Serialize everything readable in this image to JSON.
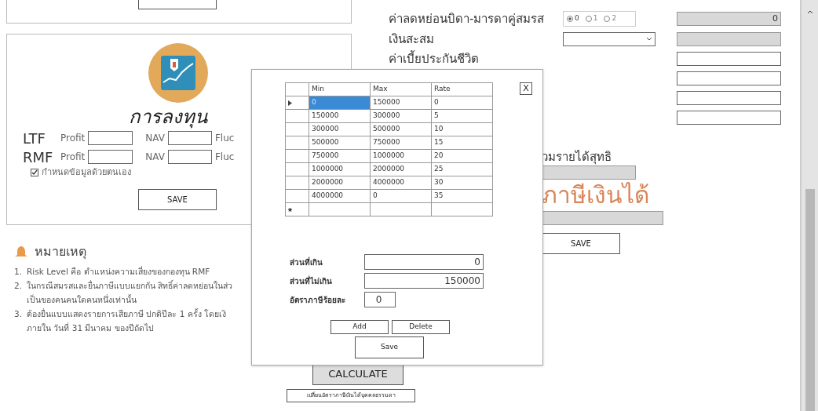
{
  "investment": {
    "title": "การลงทุน",
    "funds": [
      {
        "name": "LTF",
        "profit_label": "Profit",
        "nav_label": "NAV",
        "fluc_label": "Fluc"
      },
      {
        "name": "RMF",
        "profit_label": "Profit",
        "nav_label": "NAV",
        "fluc_label": "Fluc"
      }
    ],
    "manual_checkbox": {
      "label": "กำหนดข้อมูลด้วยตนเอง",
      "checked": true
    },
    "save_button": "SAVE"
  },
  "notes": {
    "title": "หมายเหตุ",
    "items": [
      {
        "number": "1.",
        "lines": [
          "Risk Level คือ ตำแหน่งความเสี่ยงของกองทุน RMF"
        ]
      },
      {
        "number": "2.",
        "lines": [
          "ในกรณีสมรสและยื่นภาษีแบบแยกกัน สิทธิ์ค่าลดหย่อนในส่ว",
          "เป็นของคนคนใดคนหนึ่งเท่านั้น"
        ]
      },
      {
        "number": "3.",
        "lines": [
          "ต้องยื่นแบบแสดงรายการเสียภาษี ปกติปีละ 1 ครั้ง โดยเงิ",
          "ภายใน วันที่ 31 มีนาคม ของปีถัดไป"
        ]
      }
    ]
  },
  "deductions": [
    {
      "kind": "radio",
      "label": "ค่าลดหย่อนบิดา-มารดาคู่สมรส",
      "options": [
        {
          "label": "0",
          "selected": true
        },
        {
          "label": "1",
          "selected": false
        },
        {
          "label": "2",
          "selected": false
        }
      ],
      "value": "0",
      "disabled": true
    },
    {
      "kind": "select",
      "label": "เงินสะสม",
      "disabled": true
    },
    {
      "kind": "field",
      "label": "ค่าเบี้ยประกันชีวิต",
      "disabled": false
    },
    {
      "kind": "field",
      "disabled": false
    },
    {
      "kind": "field",
      "disabled": false
    },
    {
      "kind": "field",
      "disabled": false
    }
  ],
  "net_income": {
    "label": "วมรายได้สุทธิ"
  },
  "income_tax": {
    "label": "ภาษีเงินได้"
  },
  "save_button": "SAVE",
  "calculate_button": "CALCULATE",
  "change_rate_button": "เปลี่ยนอัตราภาษีเงินได้บุคคลธรรมดา",
  "rate_dialog": {
    "close": "X",
    "columns": [
      "Min",
      "Max",
      "Rate"
    ],
    "rows": [
      {
        "cells": [
          "0",
          "150000",
          "0"
        ],
        "selected": true
      },
      {
        "cells": [
          "150000",
          "300000",
          "5"
        ],
        "selected": false
      },
      {
        "cells": [
          "300000",
          "500000",
          "10"
        ],
        "selected": false
      },
      {
        "cells": [
          "500000",
          "750000",
          "15"
        ],
        "selected": false
      },
      {
        "cells": [
          "750000",
          "1000000",
          "20"
        ],
        "selected": false
      },
      {
        "cells": [
          "1000000",
          "2000000",
          "25"
        ],
        "selected": false
      },
      {
        "cells": [
          "2000000",
          "4000000",
          "30"
        ],
        "selected": false
      },
      {
        "cells": [
          "4000000",
          "0",
          "35"
        ],
        "selected": false
      }
    ],
    "fields": [
      {
        "label": "ส่วนที่เกิน",
        "value": "0"
      },
      {
        "label": "ส่วนที่ไม่เกิน",
        "value": "150000"
      },
      {
        "label": "อัตราภาษีร้อยละ",
        "value": "0"
      }
    ],
    "buttons": [
      "Add",
      "Delete",
      "Save"
    ]
  }
}
